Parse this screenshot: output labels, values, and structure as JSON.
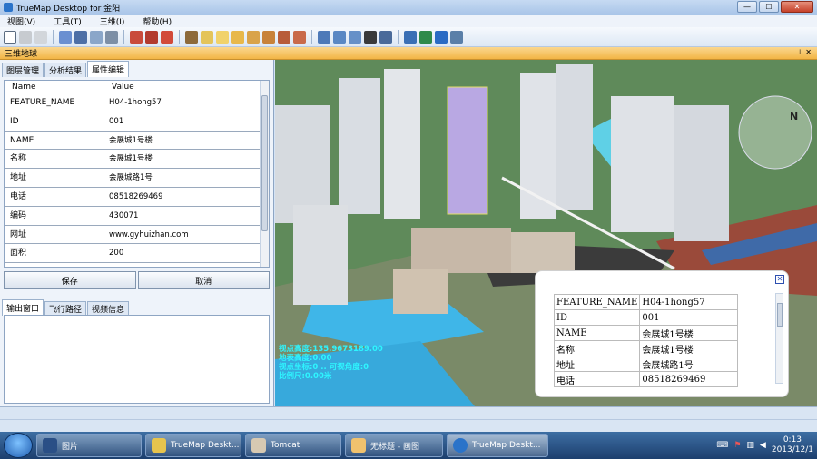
{
  "window": {
    "title": "TrueMap Desktop for 金阳"
  },
  "menu": [
    "视图(V)",
    "工具(T)",
    "三维(I)",
    "帮助(H)"
  ],
  "panel_header": "三维地球",
  "left_tabs": [
    "图层管理",
    "分析结果",
    "属性编辑"
  ],
  "attr_grid": {
    "headers": [
      "Name",
      "Value"
    ],
    "rows": [
      {
        "k": "FEATURE_NAME",
        "v": "H04-1hong57"
      },
      {
        "k": "ID",
        "v": "001"
      },
      {
        "k": "NAME",
        "v": "会展城1号楼"
      },
      {
        "k": "名称",
        "v": "会展城1号楼"
      },
      {
        "k": "地址",
        "v": "会展城路1号"
      },
      {
        "k": "电话",
        "v": "08518269469"
      },
      {
        "k": "编码",
        "v": "430071"
      },
      {
        "k": "网址",
        "v": "www.gyhuizhan.com"
      },
      {
        "k": "面积",
        "v": "200"
      }
    ]
  },
  "buttons": {
    "save": "保存",
    "cancel": "取消"
  },
  "bottom_tabs": [
    "输出窗口",
    "飞行路径",
    "视频信息"
  ],
  "popup": {
    "rows": [
      {
        "k": "FEATURE_NAME",
        "v": "H04-1hong57"
      },
      {
        "k": "ID",
        "v": "001"
      },
      {
        "k": "NAME",
        "v": "会展城1号楼"
      },
      {
        "k": "名称",
        "v": "会展城1号楼"
      },
      {
        "k": "地址",
        "v": "会展城路1号"
      },
      {
        "k": "电话",
        "v": "08518269469"
      }
    ]
  },
  "map_status": {
    "line1": "视点高度:135.9673189.00",
    "line2": "地表高度:0.00",
    "line3": "视点坐标:0 .. 可视角度:0",
    "line4": "比例尺:0.00米"
  },
  "taskbar": {
    "items": [
      "图片",
      "TrueMap Deskt...",
      "Tomcat",
      "无标题 - 画图",
      "TrueMap Deskt..."
    ],
    "time": "0:13",
    "date": "2013/12/1"
  },
  "colors": {
    "accent_header": "#f2b545",
    "map_text": "#2ef5ff",
    "taskbar": "#1d3f6e"
  }
}
